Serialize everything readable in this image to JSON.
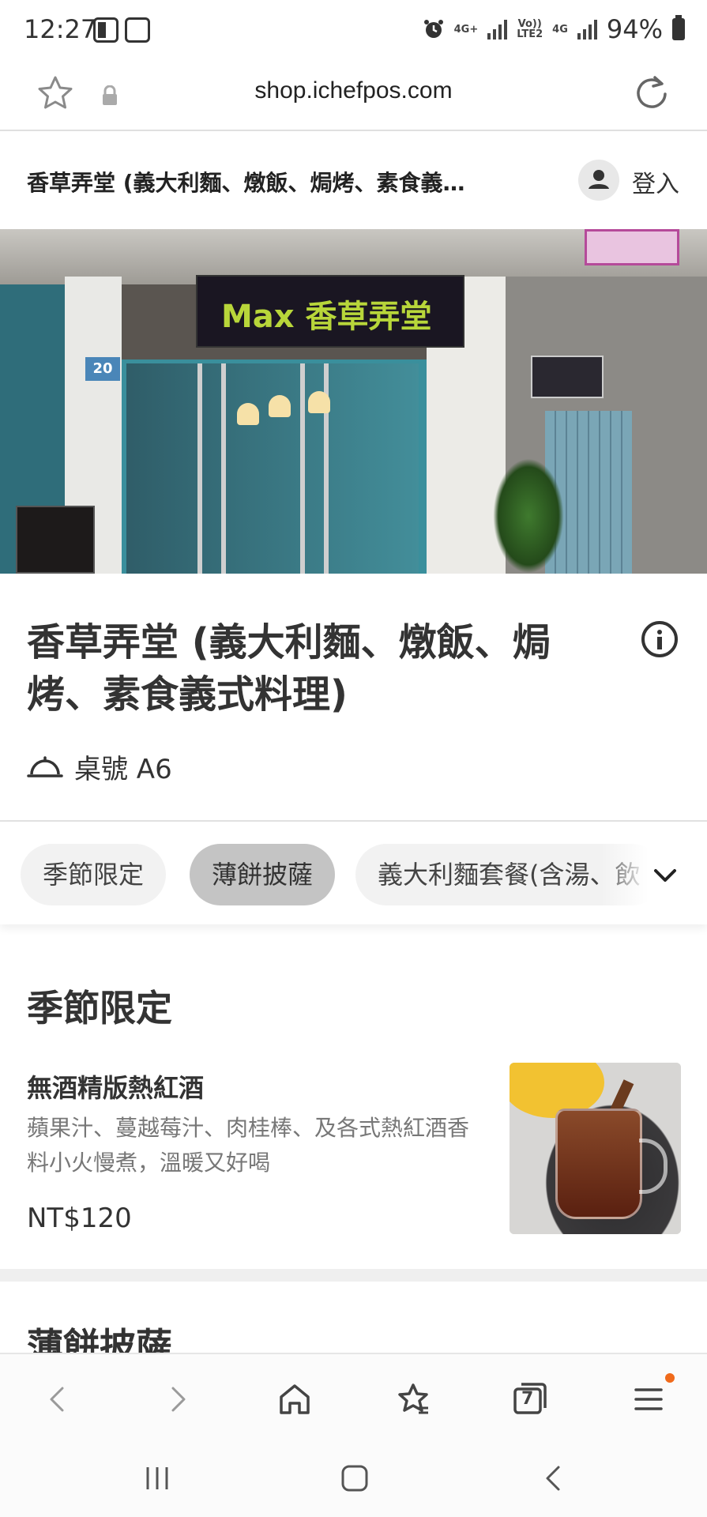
{
  "status_bar": {
    "time": "12:27",
    "battery": "94%",
    "network_1": "4G+",
    "network_2a": "Vo))",
    "network_2b": "LTE2",
    "network_3": "4G"
  },
  "browser": {
    "url": "shop.ichefpos.com"
  },
  "store_header": {
    "title": "香草弄堂 (義大利麵、燉飯、焗烤、素食義…",
    "login_label": "登入"
  },
  "hero": {
    "address_plate": "20",
    "sign_text": "Max 香草弄堂"
  },
  "store": {
    "name": "香草弄堂 (義大利麵、燉飯、焗烤、素食義式料理)",
    "table_label": "桌號 A6"
  },
  "category_tabs": [
    {
      "label": "季節限定",
      "active": false
    },
    {
      "label": "薄餅披薩",
      "active": true
    },
    {
      "label": "義大利麵套餐(含湯、飲",
      "active": false
    }
  ],
  "sections": [
    {
      "title": "季節限定",
      "items": [
        {
          "name": "無酒精版熱紅酒",
          "description": "蘋果汁、蔓越莓汁、肉桂棒、及各式熱紅酒香料小火慢煮，溫暖又好喝",
          "price": "NT$120",
          "photo_icon": "mulled-wine-photo"
        }
      ]
    },
    {
      "title": "薄餅披薩"
    }
  ],
  "browser_nav": {
    "tab_count": "7"
  },
  "colors": {
    "active_tab": "#c4c4c4",
    "inactive_tab": "#f2f2f2",
    "notification_dot": "#f06a1b"
  }
}
